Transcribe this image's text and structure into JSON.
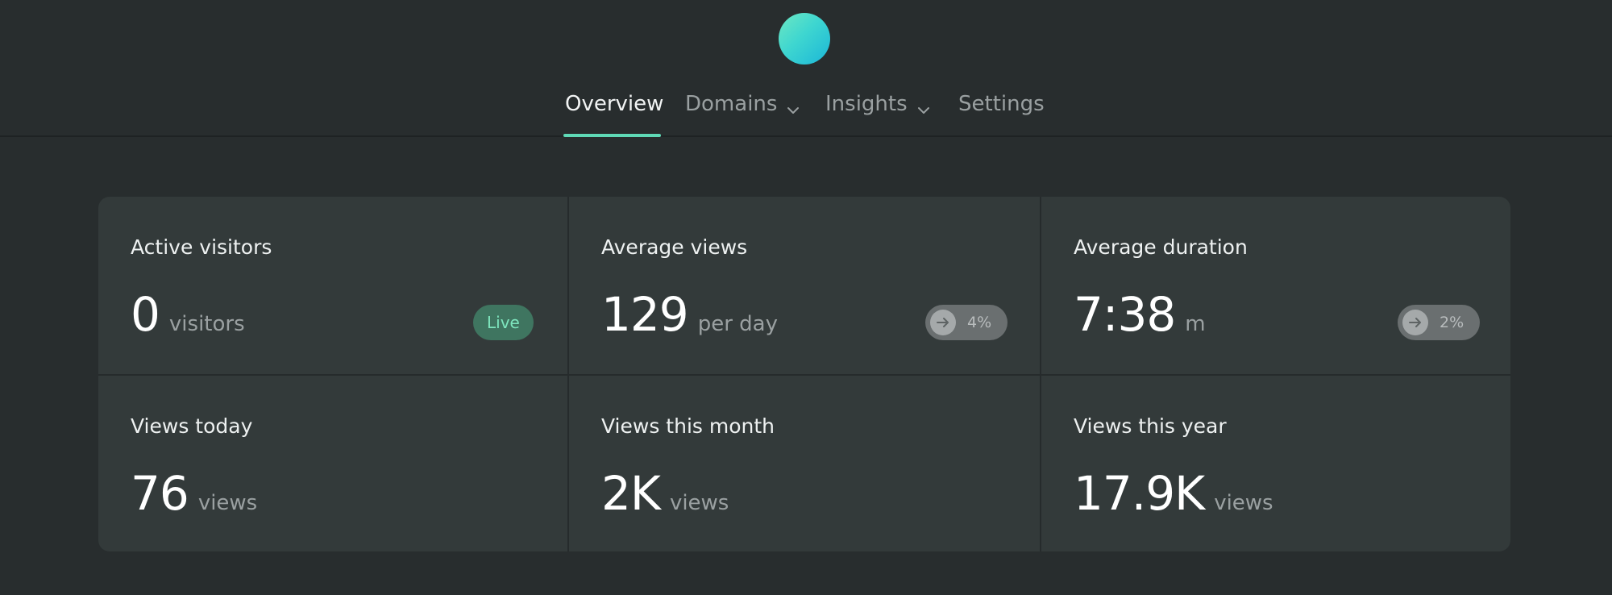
{
  "nav": {
    "items": [
      {
        "label": "Overview",
        "active": true
      },
      {
        "label": "Domains",
        "dropdown": true
      },
      {
        "label": "Insights",
        "dropdown": true
      },
      {
        "label": "Settings"
      }
    ]
  },
  "stats": {
    "active_visitors": {
      "title": "Active visitors",
      "value": "0",
      "unit": "visitors",
      "badge": "Live"
    },
    "average_views": {
      "title": "Average views",
      "value": "129",
      "unit": "per day",
      "trend": "4%",
      "trend_icon": "arrow-right-icon"
    },
    "average_duration": {
      "title": "Average duration",
      "value": "7:38",
      "unit": "m",
      "trend": "2%",
      "trend_icon": "arrow-right-icon"
    },
    "views_today": {
      "title": "Views today",
      "value": "76",
      "unit": "views"
    },
    "views_month": {
      "title": "Views this month",
      "value": "2K",
      "unit": "views"
    },
    "views_year": {
      "title": "Views this year",
      "value": "17.9K",
      "unit": "views"
    }
  },
  "colors": {
    "accent": "#5fd9b6",
    "background": "#282d2e",
    "card": "#333a3a",
    "live_badge_bg": "#3f7560",
    "live_badge_text": "#7ee6be"
  }
}
